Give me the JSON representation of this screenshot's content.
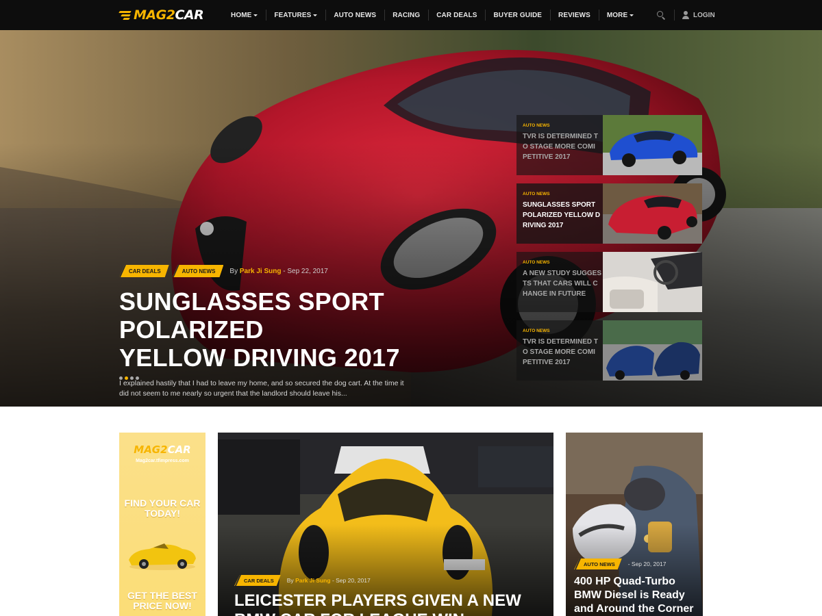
{
  "brand": {
    "logo_part1": "MAG2",
    "logo_part2": "CAR",
    "accent": "#f7b500"
  },
  "nav": {
    "items": [
      {
        "label": "HOME",
        "dropdown": true
      },
      {
        "label": "FEATURES",
        "dropdown": true
      },
      {
        "label": "AUTO NEWS",
        "dropdown": false
      },
      {
        "label": "RACING",
        "dropdown": false
      },
      {
        "label": "CAR DEALS",
        "dropdown": false
      },
      {
        "label": "BUYER GUIDE",
        "dropdown": false
      },
      {
        "label": "REVIEWS",
        "dropdown": false
      },
      {
        "label": "MORE",
        "dropdown": true
      }
    ],
    "search_icon": "search-icon",
    "user_icon": "user-icon",
    "login_label": "LOGIN"
  },
  "hero": {
    "tags": [
      "CAR DEALS",
      "AUTO NEWS"
    ],
    "by_label": "By",
    "author": "Park Ji Sung",
    "date": "- Sep 22, 2017",
    "title_line1": "SUNGLASSES SPORT POLARIZED",
    "title_line2": "YELLOW DRIVING 2017",
    "excerpt": "I explained hastily that I had to leave my home, and so secured the dog cart. At the time it did not seem to me nearly so urgent that the landlord should leave his...",
    "slides_total": 4,
    "active_slide": 2
  },
  "side_posts": [
    {
      "tag": "AUTO NEWS",
      "title": "TVR IS DETERMINED TO STAGE MORE COMI PETITIVE 2017",
      "active": false
    },
    {
      "tag": "AUTO NEWS",
      "title": "SUNGLASSES SPORT POLARIZED YELLOW DRIVING 2017",
      "active": true
    },
    {
      "tag": "AUTO NEWS",
      "title": "A NEW STUDY SUGGESTS THAT CARS WILL CHANGE IN FUTURE",
      "active": false
    },
    {
      "tag": "AUTO NEWS",
      "title": "TVR IS DETERMINED TO STAGE MORE COMI PETITIVE 2017",
      "active": false
    }
  ],
  "ad": {
    "logo_part1": "MAG2",
    "logo_part2": "CAR",
    "url": "Mag2car.tfimpress.com",
    "cta_top": "FIND YOUR CAR TODAY!",
    "cta_bottom": "GET THE BEST PRICE NOW!"
  },
  "cards": [
    {
      "tag": "CAR DEALS",
      "by_label": "By",
      "author": "Park Ji Sung",
      "date": "- Sep 20, 2017",
      "title": "LEICESTER PLAYERS GIVEN A NEW BMW CAR FOR LEAGUE WIN"
    },
    {
      "tag": "AUTO NEWS",
      "date": "- Sep 20, 2017",
      "title": "400 HP Quad-Turbo BMW Diesel is Ready and Around the Corner"
    }
  ]
}
